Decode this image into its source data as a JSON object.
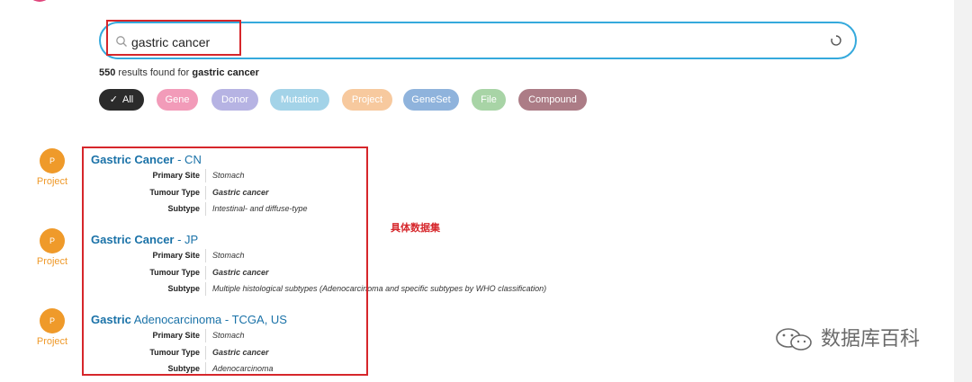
{
  "search": {
    "value": "gastric cancer"
  },
  "results_summary": {
    "count": "550",
    "text": " results found for ",
    "query": "gastric cancer"
  },
  "filters": [
    {
      "label": "All",
      "color": "#2b2b2b",
      "selected": true
    },
    {
      "label": "Gene",
      "color": "#f29bb9"
    },
    {
      "label": "Donor",
      "color": "#b6b3e3"
    },
    {
      "label": "Mutation",
      "color": "#a3d3e8"
    },
    {
      "label": "Project",
      "color": "#f7c99e"
    },
    {
      "label": "GeneSet",
      "color": "#8fb3dc"
    },
    {
      "label": "File",
      "color": "#a8d4a6"
    },
    {
      "label": "Compound",
      "color": "#ac7c86"
    }
  ],
  "results": [
    {
      "icon_letter": "P",
      "type": "Project",
      "title_bold": "Gastric Cancer",
      "title_rest": " - CN",
      "fields": [
        {
          "label": "Primary Site",
          "value": "Stomach"
        },
        {
          "label": "Tumour Type",
          "value": "Gastric cancer"
        },
        {
          "label": "Subtype",
          "value": "Intestinal- and diffuse-type"
        }
      ]
    },
    {
      "icon_letter": "P",
      "type": "Project",
      "title_bold": "Gastric Cancer",
      "title_rest": " - JP",
      "fields": [
        {
          "label": "Primary Site",
          "value": "Stomach"
        },
        {
          "label": "Tumour Type",
          "value": "Gastric cancer"
        },
        {
          "label": "Subtype",
          "value": "Multiple histological subtypes (Adenocarcinoma and specific subtypes by WHO classification)"
        }
      ]
    },
    {
      "icon_letter": "P",
      "type": "Project",
      "title_bold": "Gastric",
      "title_rest": " Adenocarcinoma - TCGA, US",
      "fields": [
        {
          "label": "Primary Site",
          "value": "Stomach"
        },
        {
          "label": "Tumour Type",
          "value": "Gastric cancer"
        },
        {
          "label": "Subtype",
          "value": "Adenocarcinoma"
        }
      ]
    }
  ],
  "annotation": "具体数据集",
  "watermark": "数据库百科",
  "colors": {
    "accent": "#35a9dc",
    "link": "#1a72a8",
    "project": "#ef9a2a",
    "highlight": "#d6262b"
  }
}
